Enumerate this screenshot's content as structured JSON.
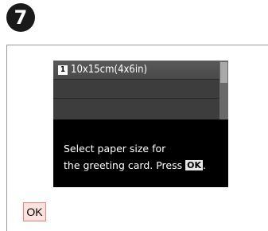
{
  "step": {
    "number": "7"
  },
  "lcd": {
    "paper_options": [
      {
        "index": "1",
        "label": "10x15cm(4x6in)",
        "selected": true
      },
      {
        "index": "",
        "label": "",
        "selected": false
      },
      {
        "index": "",
        "label": "",
        "selected": false
      }
    ],
    "message_line1": "Select paper size for",
    "message_line2_prefix": "the greeting card. Press",
    "message_key": "OK",
    "message_line2_suffix": "."
  },
  "controls": {
    "ok_button_label": "OK"
  },
  "colors": {
    "ok_button_bg": "#fde3df",
    "ok_button_border": "#e5837a",
    "lcd_background": "#000000"
  }
}
